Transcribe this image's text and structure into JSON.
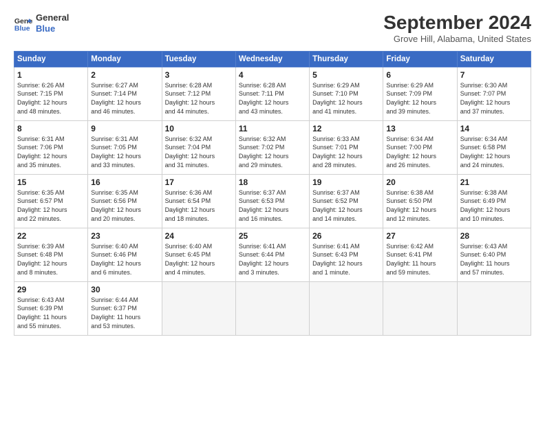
{
  "header": {
    "logo_line1": "General",
    "logo_line2": "Blue",
    "month_title": "September 2024",
    "location": "Grove Hill, Alabama, United States"
  },
  "weekdays": [
    "Sunday",
    "Monday",
    "Tuesday",
    "Wednesday",
    "Thursday",
    "Friday",
    "Saturday"
  ],
  "weeks": [
    [
      {
        "day": "1",
        "info": "Sunrise: 6:26 AM\nSunset: 7:15 PM\nDaylight: 12 hours\nand 48 minutes."
      },
      {
        "day": "2",
        "info": "Sunrise: 6:27 AM\nSunset: 7:14 PM\nDaylight: 12 hours\nand 46 minutes."
      },
      {
        "day": "3",
        "info": "Sunrise: 6:28 AM\nSunset: 7:12 PM\nDaylight: 12 hours\nand 44 minutes."
      },
      {
        "day": "4",
        "info": "Sunrise: 6:28 AM\nSunset: 7:11 PM\nDaylight: 12 hours\nand 43 minutes."
      },
      {
        "day": "5",
        "info": "Sunrise: 6:29 AM\nSunset: 7:10 PM\nDaylight: 12 hours\nand 41 minutes."
      },
      {
        "day": "6",
        "info": "Sunrise: 6:29 AM\nSunset: 7:09 PM\nDaylight: 12 hours\nand 39 minutes."
      },
      {
        "day": "7",
        "info": "Sunrise: 6:30 AM\nSunset: 7:07 PM\nDaylight: 12 hours\nand 37 minutes."
      }
    ],
    [
      {
        "day": "8",
        "info": "Sunrise: 6:31 AM\nSunset: 7:06 PM\nDaylight: 12 hours\nand 35 minutes."
      },
      {
        "day": "9",
        "info": "Sunrise: 6:31 AM\nSunset: 7:05 PM\nDaylight: 12 hours\nand 33 minutes."
      },
      {
        "day": "10",
        "info": "Sunrise: 6:32 AM\nSunset: 7:04 PM\nDaylight: 12 hours\nand 31 minutes."
      },
      {
        "day": "11",
        "info": "Sunrise: 6:32 AM\nSunset: 7:02 PM\nDaylight: 12 hours\nand 29 minutes."
      },
      {
        "day": "12",
        "info": "Sunrise: 6:33 AM\nSunset: 7:01 PM\nDaylight: 12 hours\nand 28 minutes."
      },
      {
        "day": "13",
        "info": "Sunrise: 6:34 AM\nSunset: 7:00 PM\nDaylight: 12 hours\nand 26 minutes."
      },
      {
        "day": "14",
        "info": "Sunrise: 6:34 AM\nSunset: 6:58 PM\nDaylight: 12 hours\nand 24 minutes."
      }
    ],
    [
      {
        "day": "15",
        "info": "Sunrise: 6:35 AM\nSunset: 6:57 PM\nDaylight: 12 hours\nand 22 minutes."
      },
      {
        "day": "16",
        "info": "Sunrise: 6:35 AM\nSunset: 6:56 PM\nDaylight: 12 hours\nand 20 minutes."
      },
      {
        "day": "17",
        "info": "Sunrise: 6:36 AM\nSunset: 6:54 PM\nDaylight: 12 hours\nand 18 minutes."
      },
      {
        "day": "18",
        "info": "Sunrise: 6:37 AM\nSunset: 6:53 PM\nDaylight: 12 hours\nand 16 minutes."
      },
      {
        "day": "19",
        "info": "Sunrise: 6:37 AM\nSunset: 6:52 PM\nDaylight: 12 hours\nand 14 minutes."
      },
      {
        "day": "20",
        "info": "Sunrise: 6:38 AM\nSunset: 6:50 PM\nDaylight: 12 hours\nand 12 minutes."
      },
      {
        "day": "21",
        "info": "Sunrise: 6:38 AM\nSunset: 6:49 PM\nDaylight: 12 hours\nand 10 minutes."
      }
    ],
    [
      {
        "day": "22",
        "info": "Sunrise: 6:39 AM\nSunset: 6:48 PM\nDaylight: 12 hours\nand 8 minutes."
      },
      {
        "day": "23",
        "info": "Sunrise: 6:40 AM\nSunset: 6:46 PM\nDaylight: 12 hours\nand 6 minutes."
      },
      {
        "day": "24",
        "info": "Sunrise: 6:40 AM\nSunset: 6:45 PM\nDaylight: 12 hours\nand 4 minutes."
      },
      {
        "day": "25",
        "info": "Sunrise: 6:41 AM\nSunset: 6:44 PM\nDaylight: 12 hours\nand 3 minutes."
      },
      {
        "day": "26",
        "info": "Sunrise: 6:41 AM\nSunset: 6:43 PM\nDaylight: 12 hours\nand 1 minute."
      },
      {
        "day": "27",
        "info": "Sunrise: 6:42 AM\nSunset: 6:41 PM\nDaylight: 11 hours\nand 59 minutes."
      },
      {
        "day": "28",
        "info": "Sunrise: 6:43 AM\nSunset: 6:40 PM\nDaylight: 11 hours\nand 57 minutes."
      }
    ],
    [
      {
        "day": "29",
        "info": "Sunrise: 6:43 AM\nSunset: 6:39 PM\nDaylight: 11 hours\nand 55 minutes."
      },
      {
        "day": "30",
        "info": "Sunrise: 6:44 AM\nSunset: 6:37 PM\nDaylight: 11 hours\nand 53 minutes."
      },
      {
        "day": "",
        "info": ""
      },
      {
        "day": "",
        "info": ""
      },
      {
        "day": "",
        "info": ""
      },
      {
        "day": "",
        "info": ""
      },
      {
        "day": "",
        "info": ""
      }
    ]
  ]
}
